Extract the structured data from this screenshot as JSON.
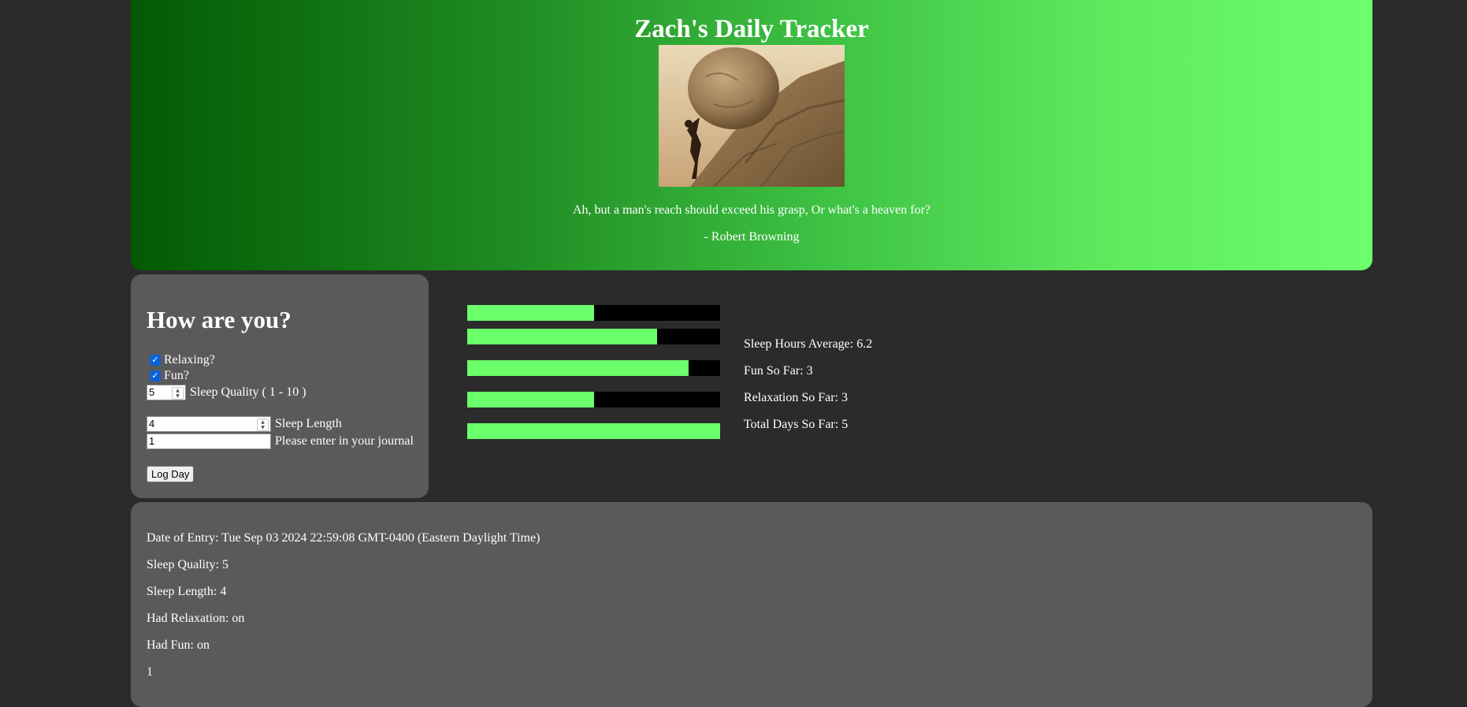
{
  "header": {
    "title": "Zach's Daily Tracker",
    "quote": "Ah, but a man's reach should exceed his grasp, Or what's a heaven for?",
    "author": "- Robert Browning"
  },
  "form": {
    "heading": "How are you?",
    "relaxing_label": "Relaxing?",
    "relaxing_checked": true,
    "fun_label": "Fun?",
    "fun_checked": true,
    "sleep_quality_value": "5",
    "sleep_quality_label": "Sleep Quality ( 1 - 10 )",
    "sleep_length_value": "4",
    "sleep_length_label": "Sleep Length",
    "journal_value": "1",
    "journal_label": "Please enter in your journal",
    "log_button": "Log Day"
  },
  "progress_bars": [
    {
      "name": "bar-1",
      "fill": 0.5
    },
    {
      "name": "bar-2",
      "fill": 0.75
    },
    {
      "name": "bar-3",
      "fill": 0.875
    },
    {
      "name": "bar-4",
      "fill": 0.5
    },
    {
      "name": "bar-5",
      "fill": 1.0
    }
  ],
  "stats": {
    "sleep_avg": "Sleep Hours Average: 6.2",
    "fun": "Fun So Far: 3",
    "relaxation": "Relaxation So Far: 3",
    "total_days": "Total Days So Far: 5"
  },
  "entry": {
    "date": "Date of Entry: Tue Sep 03 2024 22:59:08 GMT-0400 (Eastern Daylight Time)",
    "sleep_quality": "Sleep Quality: 5",
    "sleep_length": "Sleep Length: 4",
    "relaxation": "Had Relaxation: on",
    "fun": "Had Fun: on",
    "journal": "1"
  },
  "colors": {
    "accent": "#6bff6b",
    "panel": "#5a5a5a",
    "background": "#2b2b2b"
  }
}
